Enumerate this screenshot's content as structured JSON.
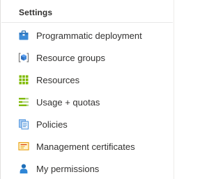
{
  "settings": {
    "header": "Settings",
    "items": [
      {
        "label": "Programmatic deployment",
        "icon": "programmatic-deployment-icon"
      },
      {
        "label": "Resource groups",
        "icon": "resource-groups-icon"
      },
      {
        "label": "Resources",
        "icon": "resources-grid-icon"
      },
      {
        "label": "Usage + quotas",
        "icon": "usage-quotas-icon"
      },
      {
        "label": "Policies",
        "icon": "policies-icon"
      },
      {
        "label": "Management certificates",
        "icon": "management-certificates-icon"
      },
      {
        "label": "My permissions",
        "icon": "my-permissions-icon"
      }
    ]
  }
}
